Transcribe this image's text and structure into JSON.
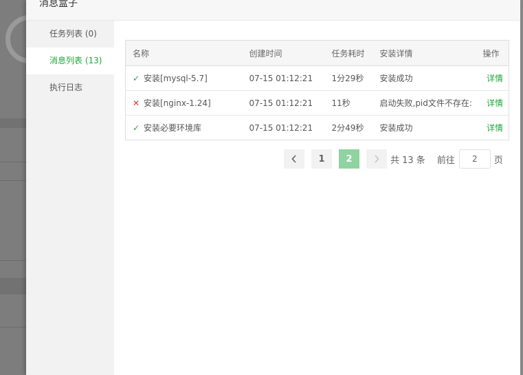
{
  "dialog": {
    "title": "消息盒子"
  },
  "sidebar": {
    "items": [
      {
        "label": "任务列表 (0)",
        "active": false
      },
      {
        "label": "消息列表 (13)",
        "active": true
      },
      {
        "label": "执行日志",
        "active": false
      }
    ]
  },
  "table": {
    "headers": {
      "name": "名称",
      "created": "创建时间",
      "duration": "任务耗时",
      "detail": "安装详情",
      "action": "操作"
    },
    "rows": [
      {
        "status": "success",
        "status_icon": "check-icon",
        "name": "安装[mysql-5.7]",
        "created": "07-15 01:12:21",
        "duration": "1分29秒",
        "detail": "安装成功",
        "action": "详情"
      },
      {
        "status": "failed",
        "status_icon": "cross-icon",
        "name": "安装[nginx-1.24]",
        "created": "07-15 01:12:21",
        "duration": "11秒",
        "detail": "启动失败,pid文件不存在:",
        "action": "详情"
      },
      {
        "status": "success",
        "status_icon": "check-icon",
        "name": "安装必要环境库",
        "created": "07-15 01:12:21",
        "duration": "2分49秒",
        "detail": "安装成功",
        "action": "详情"
      }
    ]
  },
  "pagination": {
    "pages": [
      "1",
      "2"
    ],
    "current_page": 2,
    "total_text": "共 13 条",
    "goto_label": "前往",
    "goto_value": "2",
    "page_unit": "页"
  },
  "colors": {
    "accent": "#20a53a",
    "error": "#e0362e",
    "active_page": "#8fd3a0"
  }
}
